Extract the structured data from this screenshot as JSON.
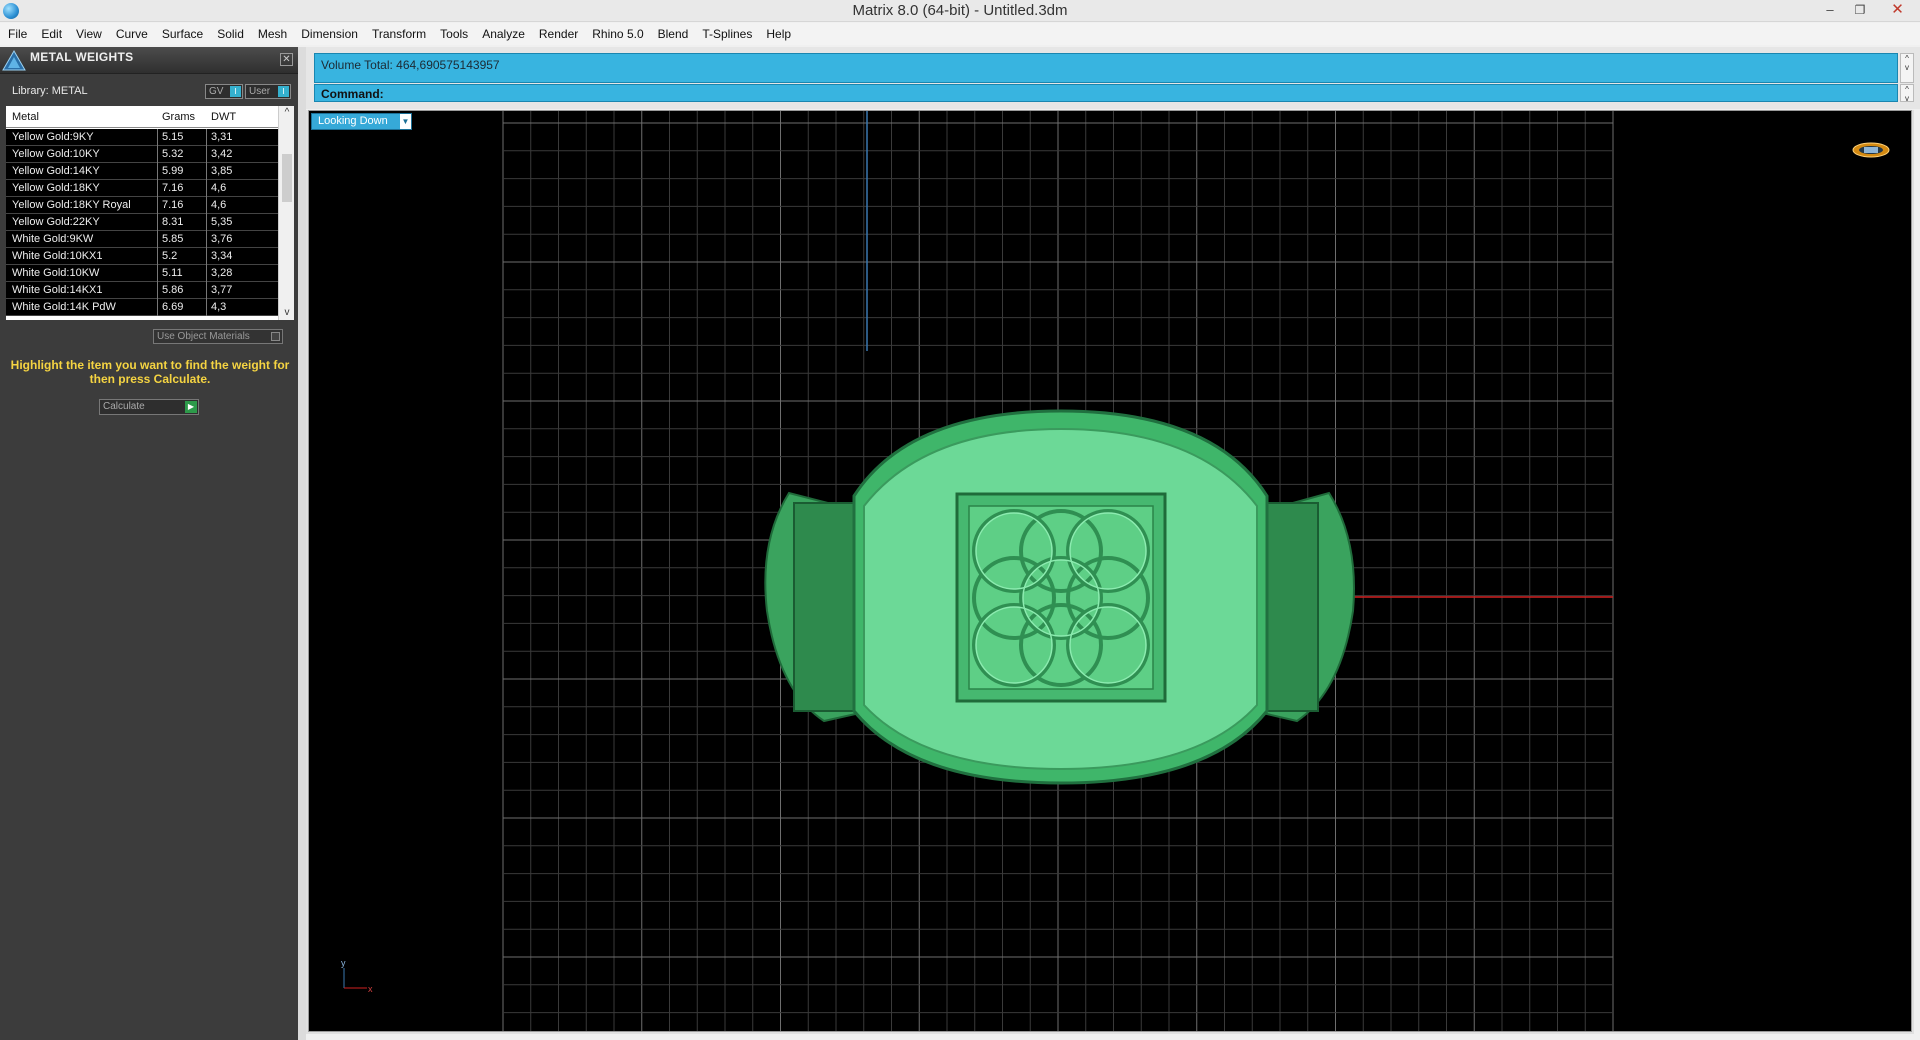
{
  "window": {
    "title": "Matrix 8.0 (64-bit) - Untitled.3dm",
    "controls": [
      "–",
      "❐",
      "✕"
    ]
  },
  "menu": [
    "File",
    "Edit",
    "View",
    "Curve",
    "Surface",
    "Solid",
    "Mesh",
    "Dimension",
    "Transform",
    "Tools",
    "Analyze",
    "Render",
    "Rhino 5.0",
    "Blend",
    "T-Splines",
    "Help"
  ],
  "panel": {
    "title": "METAL WEIGHTS",
    "close": "✕",
    "library_label": "Library: METAL",
    "toggle_gv": "GV",
    "toggle_user": "User",
    "toggle_knob": "I",
    "table": {
      "headers": [
        "Metal",
        "Grams",
        "DWT"
      ],
      "rows": [
        [
          "Yellow Gold:9KY",
          "5.15",
          "3,31"
        ],
        [
          "Yellow Gold:10KY",
          "5.32",
          "3,42"
        ],
        [
          "Yellow Gold:14KY",
          "5.99",
          "3,85"
        ],
        [
          "Yellow Gold:18KY",
          "7.16",
          "4,6"
        ],
        [
          "Yellow Gold:18KY Royal",
          "7.16",
          "4,6"
        ],
        [
          "Yellow Gold:22KY",
          "8.31",
          "5,35"
        ],
        [
          "White Gold:9KW",
          "5.85",
          "3,76"
        ],
        [
          "White Gold:10KX1",
          "5.2",
          "3,34"
        ],
        [
          "White Gold:10KW",
          "5.11",
          "3,28"
        ],
        [
          "White Gold:14KX1",
          "5.86",
          "3,77"
        ],
        [
          "White Gold:14K PdW",
          "6.69",
          "4,3"
        ]
      ],
      "scroll_up": "^",
      "scroll_down": "v"
    },
    "use_object_materials": "Use Object Materials",
    "hint": "Highlight the item you want to find the weight for then press Calculate.",
    "calculate": "Calculate",
    "calculate_go": "▶"
  },
  "command": {
    "history": "Volume Total: 464,690575143957",
    "label": "Command:",
    "scroll_up": "^",
    "scroll_down": "v"
  },
  "viewport": {
    "view_name": "Looking Down",
    "dropdown": "▼",
    "axis_y": "y",
    "axis_x": "x",
    "model_color": "#5cd68a",
    "background": "#000000",
    "grid_color": "#5a5a5a",
    "x_axis_color": "#d02020",
    "y_axis_color": "#3a78b0"
  }
}
